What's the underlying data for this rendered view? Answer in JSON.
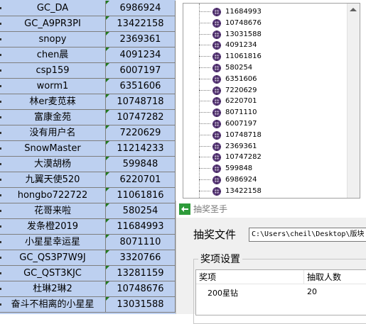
{
  "spreadsheet": {
    "rows": [
      {
        "name": "GC_DA",
        "id": "6986924"
      },
      {
        "name": "GC_A9PR3PI",
        "id": "13422158"
      },
      {
        "name": "snopy",
        "id": "2369361"
      },
      {
        "name": "chen晨",
        "id": "4091234"
      },
      {
        "name": "csp159",
        "id": "6007197"
      },
      {
        "name": "worm1",
        "id": "6351606"
      },
      {
        "name": "林er麦苋菻",
        "id": "10748718"
      },
      {
        "name": "富康金苑",
        "id": "10747282"
      },
      {
        "name": "没有用户名",
        "id": "7220629"
      },
      {
        "name": "SnowMaster",
        "id": "11214233"
      },
      {
        "name": "大漠胡杨",
        "id": "599848"
      },
      {
        "name": "九翼天使520",
        "id": "6220701"
      },
      {
        "name": "hongbo722722",
        "id": "11061816"
      },
      {
        "name": "花哥来啦",
        "id": "580254"
      },
      {
        "name": "发条橙2019",
        "id": "11684993"
      },
      {
        "name": "小星星幸运星",
        "id": "8071110"
      },
      {
        "name": "GC_QS3P7W9J",
        "id": "3320766"
      },
      {
        "name": "GC_QST3KJC",
        "id": "13281159"
      },
      {
        "name": "杜琳2琳2",
        "id": "10748676"
      },
      {
        "name": "奋斗不相离的小星星",
        "id": "13031588"
      }
    ]
  },
  "tree": {
    "items": [
      "11684993",
      "10748676",
      "13031588",
      "4091234",
      "11061816",
      "580254",
      "6351606",
      "7220629",
      "6220701",
      "8071110",
      "6007197",
      "10748718",
      "2369361",
      "10747282",
      "599848",
      "6986924",
      "13422158"
    ]
  },
  "dialog": {
    "title": "抽奖圣手",
    "file_label": "抽奖文件",
    "file_path": "C:\\Users\\cheil\\Desktop\\版块",
    "group_label": "奖项设置",
    "columns": [
      "奖项",
      "抽取人数"
    ],
    "prizes": [
      {
        "name": "200星钻",
        "count": "20"
      }
    ]
  },
  "colors": {
    "sheet_fill": "#bdd0f0",
    "accent": "#1f7a1f"
  }
}
